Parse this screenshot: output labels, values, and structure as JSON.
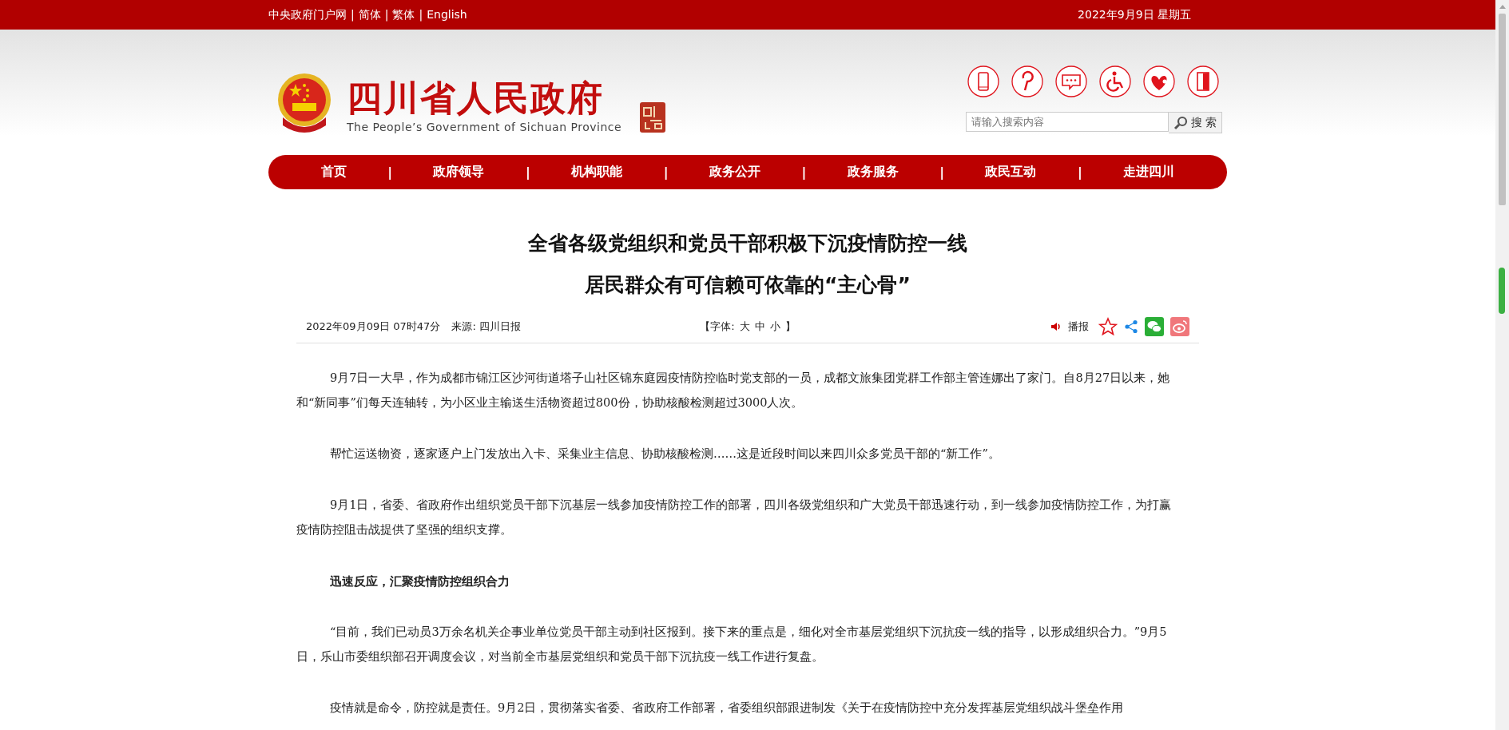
{
  "top_bar": {
    "links": [
      "中央政府门户网",
      "简体",
      "繁体",
      "English"
    ],
    "separator": "|",
    "date": "2022年9月9日 星期五"
  },
  "header": {
    "title": "四川省人民政府",
    "subtitle": "The People’s Government of Sichuan Province",
    "search": {
      "placeholder": "请输入搜索内容",
      "button": "搜 索"
    }
  },
  "nav": {
    "separator": "|",
    "items": [
      "首页",
      "政府领导",
      "机构职能",
      "政务公开",
      "政务服务",
      "政民互动",
      "走进四川"
    ]
  },
  "article": {
    "title_lines": [
      "全省各级党组织和党员干部积极下沉疫情防控一线",
      "居民群众有可信赖可依靠的“主心骨”"
    ],
    "meta": {
      "date": "2022年09月09日 07时47分",
      "source": "来源: 四川日报",
      "font_label": "【字体:",
      "font_sizes": [
        "大",
        "中",
        "小"
      ],
      "font_close": "】",
      "broadcast": "播报"
    },
    "paragraphs": [
      {
        "kind": "text",
        "text": "9月7日一大早，作为成都市锦江区沙河街道塔子山社区锦东庭园疫情防控临时党支部的一员，成都文旅集团党群工作部主管连娜出了家门。自8月27日以来，她和“新同事”们每天连轴转，为小区业主输送生活物资超过800份，协助核酸检测超过3000人次。"
      },
      {
        "kind": "text",
        "text": "帮忙运送物资，逐家逐户上门发放出入卡、采集业主信息、协助核酸检测……这是近段时间以来四川众多党员干部的“新工作”。"
      },
      {
        "kind": "text",
        "text": "9月1日，省委、省政府作出组织党员干部下沉基层一线参加疫情防控工作的部署，四川各级党组织和广大党员干部迅速行动，到一线参加疫情防控工作，为打赢疫情防控阻击战提供了坚强的组织支撑。"
      },
      {
        "kind": "heading",
        "text": "迅速反应，汇聚疫情防控组织合力"
      },
      {
        "kind": "text",
        "text": "“目前，我们已动员3万余名机关企事业单位党员干部主动到社区报到。接下来的重点是，细化对全市基层党组织下沉抗疫一线的指导，以形成组织合力。”9月5日，乐山市委组织部召开调度会议，对当前全市基层党组织和党员干部下沉抗疫一线工作进行复盘。"
      },
      {
        "kind": "text",
        "text": "疫情就是命令，防控就是责任。9月2日，贯彻落实省委、省政府工作部署，省委组织部跟进制发《关于在疫情防控中充分发挥基层党组织战斗堡垒作用"
      }
    ]
  }
}
